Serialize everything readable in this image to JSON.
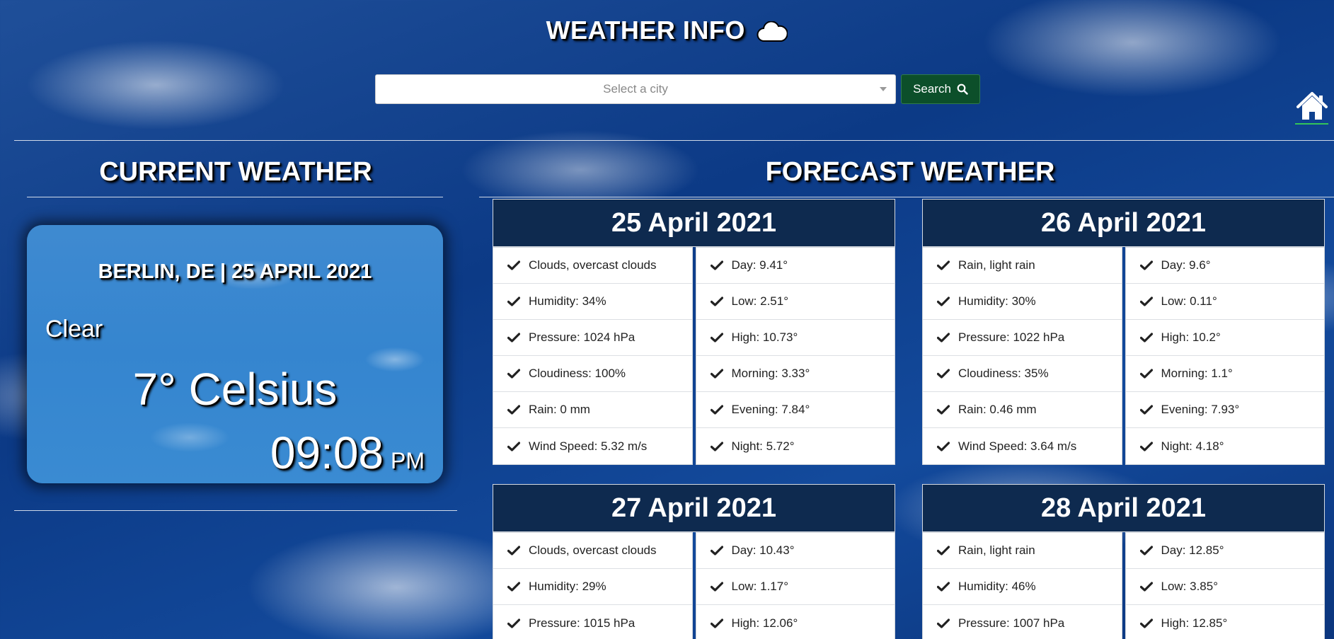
{
  "header": {
    "title": "WEATHER INFO",
    "title_icon": "cloud-icon",
    "search": {
      "placeholder": "Select a city",
      "button_label": "Search",
      "button_icon": "search-icon"
    },
    "home_icon": "home-icon"
  },
  "current": {
    "section_title": "CURRENT WEATHER",
    "location_date": "BERLIN, DE | 25 APRIL 2021",
    "condition": "Clear",
    "temperature": "7° Celsius",
    "time": "09:08",
    "ampm": "PM"
  },
  "forecast": {
    "section_title": "FORECAST WEATHER",
    "days": [
      {
        "date": "25 April 2021",
        "left": [
          "Clouds, overcast clouds",
          "Humidity: 34%",
          "Pressure: 1024 hPa",
          "Cloudiness: 100%",
          "Rain: 0 mm",
          "Wind Speed: 5.32 m/s"
        ],
        "right": [
          "Day: 9.41°",
          "Low: 2.51°",
          "High: 10.73°",
          "Morning: 3.33°",
          "Evening: 7.84°",
          "Night: 5.72°"
        ]
      },
      {
        "date": "26 April 2021",
        "left": [
          "Rain, light rain",
          "Humidity: 30%",
          "Pressure: 1022 hPa",
          "Cloudiness: 35%",
          "Rain: 0.46 mm",
          "Wind Speed: 3.64 m/s"
        ],
        "right": [
          "Day: 9.6°",
          "Low: 0.11°",
          "High: 10.2°",
          "Morning: 1.1°",
          "Evening: 7.93°",
          "Night: 4.18°"
        ]
      },
      {
        "date": "27 April 2021",
        "left": [
          "Clouds, overcast clouds",
          "Humidity: 29%",
          "Pressure: 1015 hPa"
        ],
        "right": [
          "Day: 10.43°",
          "Low: 1.17°",
          "High: 12.06°"
        ]
      },
      {
        "date": "28 April 2021",
        "left": [
          "Rain, light rain",
          "Humidity: 46%",
          "Pressure: 1007 hPa"
        ],
        "right": [
          "Day: 12.85°",
          "Low: 3.85°",
          "High: 12.85°"
        ]
      }
    ]
  },
  "colors": {
    "header_bg": "#0e2a4f",
    "search_button": "#0c4f2a",
    "home_underline": "#33c45a"
  }
}
